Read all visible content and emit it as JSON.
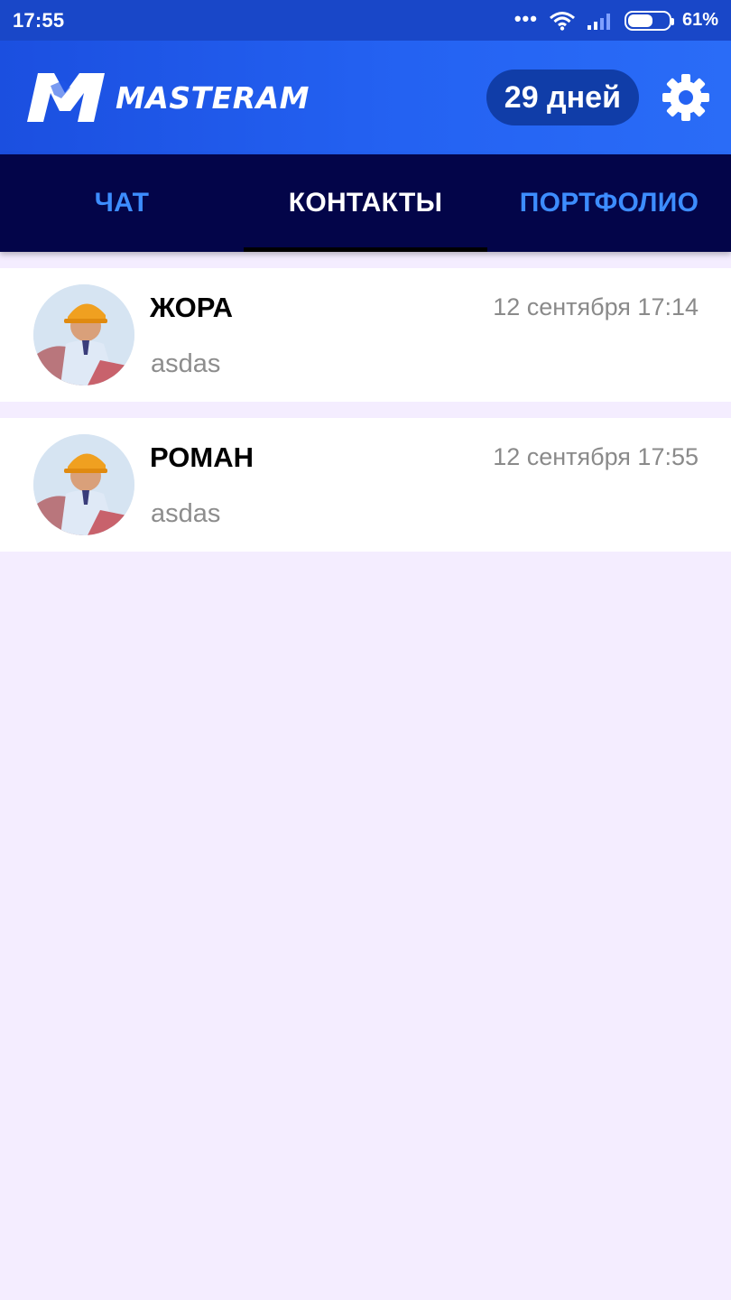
{
  "status_bar": {
    "time": "17:55",
    "dots": "•••",
    "battery_percent": "61%",
    "battery_level": 0.61,
    "icons": [
      "wifi-icon",
      "signal-icon",
      "battery-icon"
    ]
  },
  "header": {
    "logo_text": "MASTERAM",
    "days_badge": "29 дней",
    "settings_icon": "gear-icon"
  },
  "tabs": [
    {
      "label": "ЧАТ",
      "active": false
    },
    {
      "label": "КОНТАКТЫ",
      "active": true
    },
    {
      "label": "ПОРТФОЛИО",
      "active": false
    }
  ],
  "contacts": [
    {
      "name": "ЖОРА",
      "date": "12 сентября 17:14",
      "message": "asdas"
    },
    {
      "name": "РОМАН",
      "date": "12 сентября 17:55",
      "message": "asdas"
    }
  ],
  "colors": {
    "status_bar": "#1947c8",
    "header": "#2462f2",
    "tabs_bg": "#030549",
    "tab_inactive": "#3d8dff",
    "page_bg": "#f4edff"
  }
}
